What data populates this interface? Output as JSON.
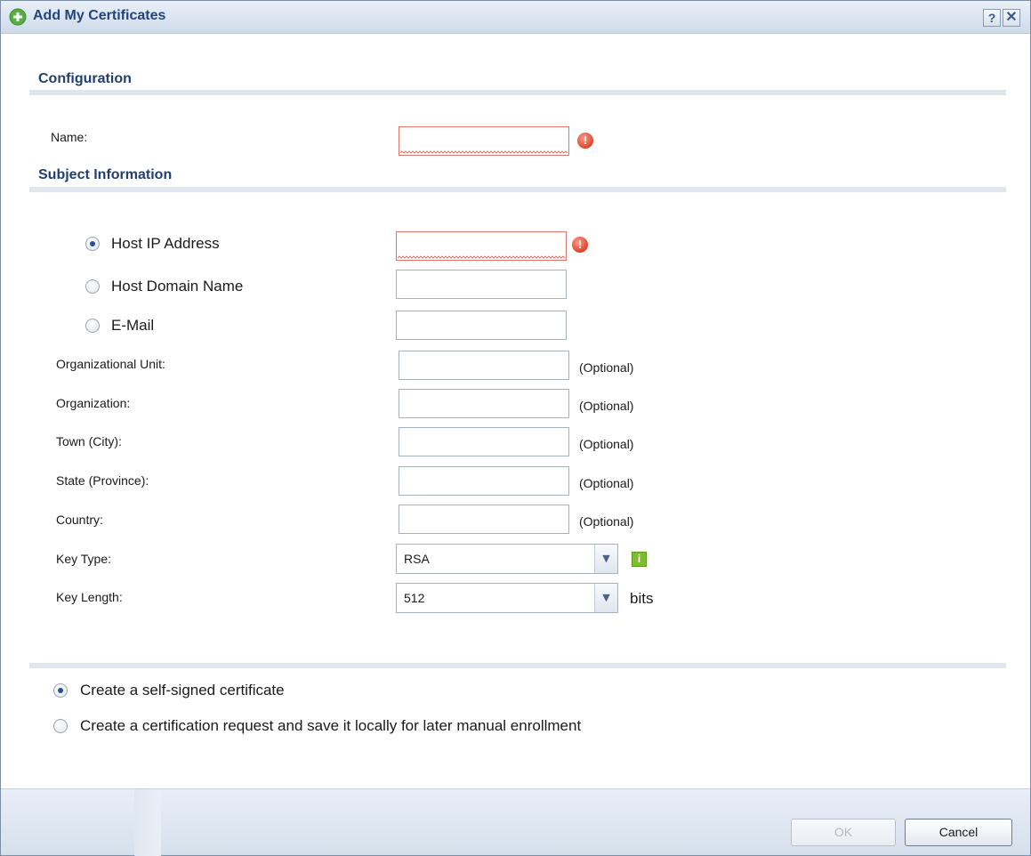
{
  "dialog": {
    "title": "Add My Certificates",
    "help": "?",
    "close": "✕"
  },
  "configuration": {
    "section_title": "Configuration",
    "name_label": "Name:",
    "name_value": ""
  },
  "subject": {
    "section_title": "Subject Information",
    "host_ip_label": "Host IP Address",
    "host_ip_value": "",
    "host_domain_label": "Host Domain Name",
    "host_domain_value": "",
    "email_label": "E-Mail",
    "email_value": "",
    "selected_identity": "Host IP Address",
    "fields": [
      {
        "label": "Organizational Unit:",
        "value": "",
        "note": "(Optional)"
      },
      {
        "label": "Organization:",
        "value": "",
        "note": "(Optional)"
      },
      {
        "label": "Town (City):",
        "value": "",
        "note": "(Optional)"
      },
      {
        "label": "State (Province):",
        "value": "",
        "note": "(Optional)"
      },
      {
        "label": "Country:",
        "value": "",
        "note": "(Optional)"
      }
    ],
    "key_type_label": "Key Type:",
    "key_type_value": "RSA",
    "key_length_label": "Key Length:",
    "key_length_value": "512",
    "key_length_unit": "bits"
  },
  "options": {
    "self_signed_label": "Create a self-signed certificate",
    "request_label": "Create a certification request and save it locally for later manual enrollment",
    "selected": "Create a self-signed certificate"
  },
  "footer": {
    "ok_label": "OK",
    "cancel_label": "Cancel"
  },
  "icons": {
    "title_icon": "add-circle-icon",
    "error_icon": "error-icon",
    "info_icon": "info-icon"
  },
  "colors": {
    "title_text": "#23457a",
    "error_border": "#e0746a",
    "info_green": "#7ebd2f"
  }
}
